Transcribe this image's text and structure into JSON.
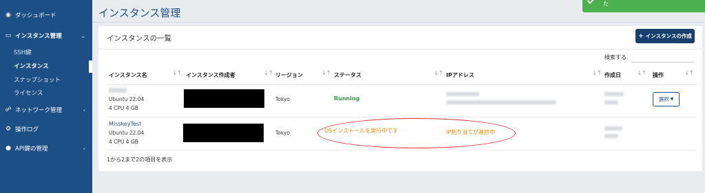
{
  "sidebar": {
    "items": [
      {
        "label": "ダッシュボード",
        "icon": "dashboard-icon"
      },
      {
        "label": "インスタンス管理",
        "icon": "monitor-icon",
        "chevron": "⌄"
      },
      {
        "label": "ネットワーク管理",
        "icon": "network-icon",
        "chevron": "‹"
      },
      {
        "label": "操作ログ",
        "icon": "gear-icon"
      },
      {
        "label": "API鍵の管理",
        "icon": "user-icon",
        "chevron": "‹"
      }
    ],
    "sub_items": [
      {
        "label": "SSH鍵"
      },
      {
        "label": "インスタンス"
      },
      {
        "label": "スナップショット"
      },
      {
        "label": "ライセンス"
      }
    ]
  },
  "page": {
    "title": "インスタンス管理"
  },
  "toast": {
    "text": "た"
  },
  "card": {
    "title": "インスタンスの一覧",
    "create_button": "インスタンスの作成",
    "search_label": "検索する",
    "footer": "1から2まで2の項目を表示"
  },
  "table": {
    "columns": [
      "インスタンス名",
      "インスタンス作成者",
      "リージョン",
      "ステータス",
      "IPアドレス",
      "作成日",
      "操作"
    ],
    "rows": [
      {
        "name": "",
        "os": "Ubuntu 22.04",
        "spec": "4 CPU 4 GB",
        "region": "Tokyo",
        "status": "Running",
        "ip": "",
        "action": "選択"
      },
      {
        "name": "MisskeyTest",
        "os": "Ubuntu 22.04",
        "spec": "4 CPU 4 GB",
        "region": "Tokyo",
        "status": "OSインストールを実行中です",
        "ip": "IP割り当てが進捗中",
        "action": ""
      }
    ]
  },
  "colors": {
    "sidebar": "#1b4f86",
    "accent": "#173f6e",
    "running": "#2e9a4a",
    "pending": "#f08a00",
    "annotation": "#e03030",
    "toast": "#4caf50"
  }
}
